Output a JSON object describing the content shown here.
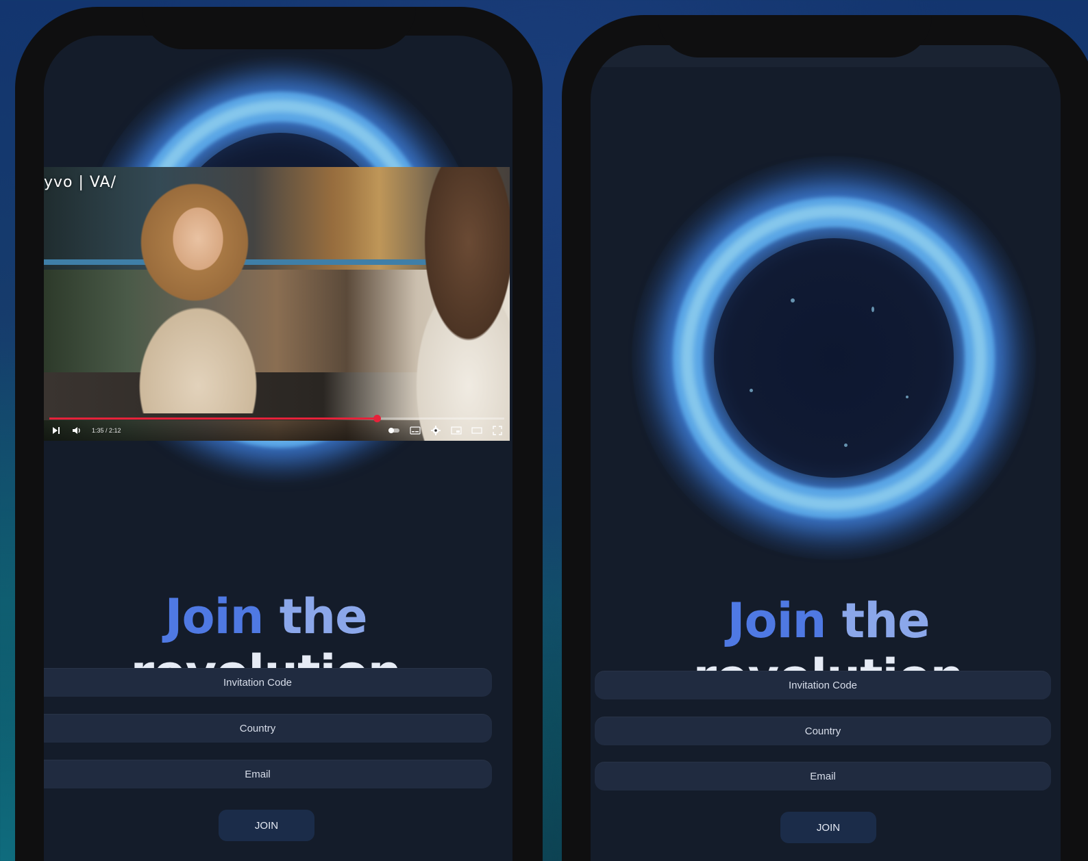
{
  "left_phone": {
    "video": {
      "logo_text": "yvo | VA/",
      "time_label": "1:35 / 2:12",
      "progress": 0.72
    },
    "headline": {
      "word1": "Join",
      "word2": "the",
      "word3": "revolution"
    },
    "form": {
      "invitation_label": "Invitation Code",
      "country_label": "Country",
      "email_label": "Email",
      "join_label": "JOIN"
    }
  },
  "right_phone": {
    "headline": {
      "word1": "Join",
      "word2": "the",
      "word3": "revolution"
    },
    "form": {
      "invitation_label": "Invitation Code",
      "country_label": "Country",
      "email_label": "Email",
      "join_label": "JOIN"
    }
  },
  "colors": {
    "headline_blue": "#4f79e3",
    "headline_light": "#e6ebf5",
    "field_bg": "#202b40",
    "orb_ring": "#5aa6e6",
    "progress_red": "#e6223a"
  },
  "icons": [
    "play-icon",
    "volume-icon",
    "subtitles-icon",
    "settings-icon",
    "miniplayer-icon",
    "theater-icon",
    "fullscreen-icon"
  ]
}
